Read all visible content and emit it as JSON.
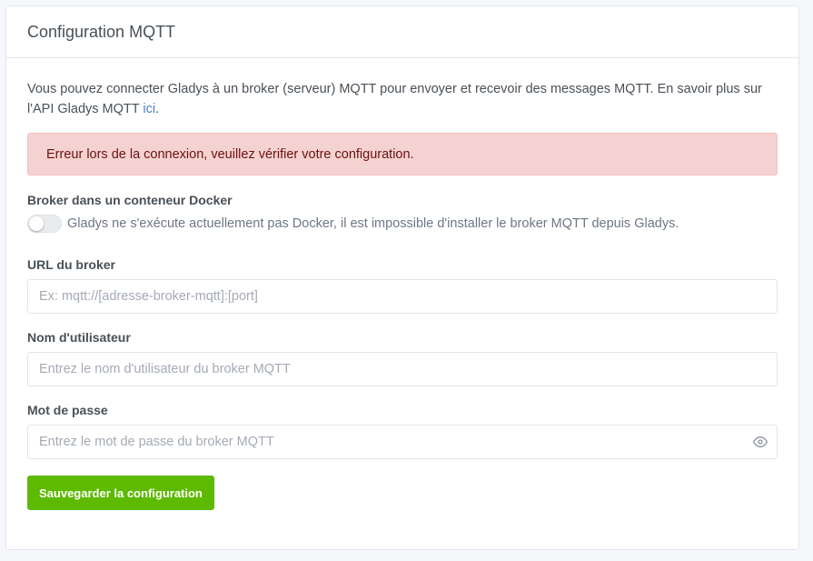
{
  "card": {
    "title": "Configuration MQTT"
  },
  "intro": {
    "text": "Vous pouvez connecter Gladys à un broker (serveur) MQTT pour envoyer et recevoir des messages MQTT. En savoir plus sur l'API Gladys MQTT ",
    "link_label": "ici",
    "after_link": "."
  },
  "alert": {
    "text": "Erreur lors de la connexion, veuillez vérifier votre configuration."
  },
  "docker": {
    "label": "Broker dans un conteneur Docker",
    "toggle_on": false,
    "toggle_text": "Gladys ne s'exécute actuellement pas Docker, il est impossible d'installer le broker MQTT depuis Gladys."
  },
  "url": {
    "label": "URL du broker",
    "value": "",
    "placeholder": "Ex: mqtt://[adresse-broker-mqtt]:[port]"
  },
  "username": {
    "label": "Nom d'utilisateur",
    "value": "",
    "placeholder": "Entrez le nom d'utilisateur du broker MQTT"
  },
  "password": {
    "label": "Mot de passe",
    "value": "",
    "placeholder": "Entrez le mot de passe du broker MQTT",
    "reveal_icon": "eye-icon"
  },
  "actions": {
    "save_label": "Sauvegarder la configuration"
  },
  "colors": {
    "link": "#467fcf",
    "alert_bg": "#f5d2d2",
    "alert_text": "#6b1110",
    "save_button": "#5eba00"
  }
}
